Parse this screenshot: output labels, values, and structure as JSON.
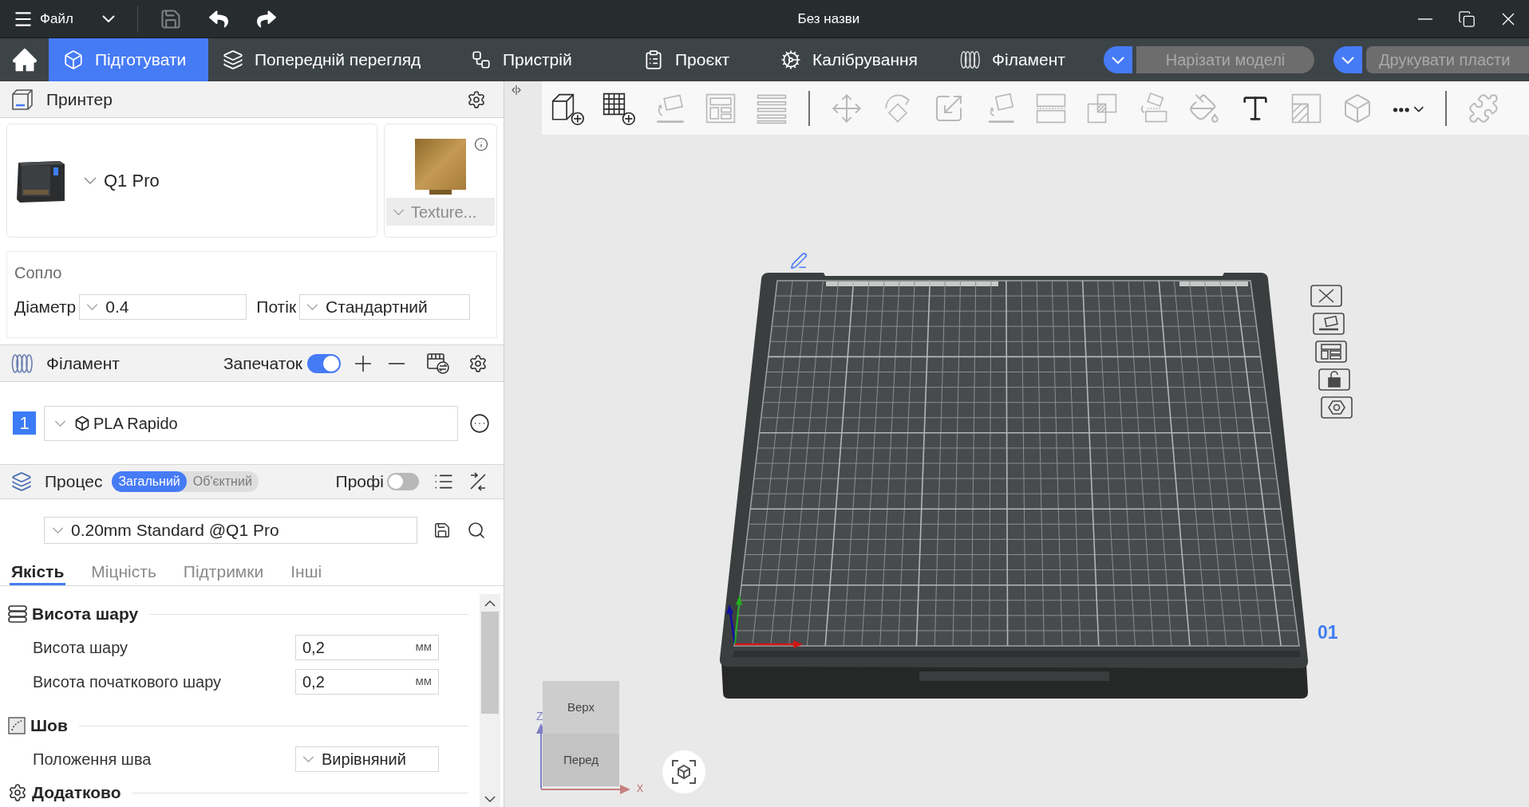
{
  "title_bar": {
    "menu_label": "Файл",
    "title": "Без назви",
    "quick_actions": [
      {
        "disabled": true
      },
      {
        "disabled": false
      },
      {
        "disabled": false
      }
    ]
  },
  "main_tabs": [
    {
      "label": "Підготувати",
      "selected": true
    },
    {
      "label": "Попередній перегляд",
      "selected": false
    },
    {
      "label": "Пристрій",
      "selected": false
    },
    {
      "label": "Проєкт",
      "selected": false
    },
    {
      "label": "Калібрування",
      "selected": false
    },
    {
      "label": "Філамент",
      "selected": false
    }
  ],
  "actions": [
    {
      "label": "Нарізати моделі",
      "disabled": true
    },
    {
      "label": "Друкувати пласти",
      "disabled": true
    }
  ],
  "printer": {
    "title": "Принтер",
    "model": "Q1 Pro",
    "plate_type": "Texture..."
  },
  "nozzle": {
    "title": "Сопло",
    "diameter_label": "Діаметр",
    "diameter": "0.4",
    "flow_label": "Потік",
    "flow": "Стандартний"
  },
  "filament": {
    "title": "Філамент",
    "afterprint_label": "Запечаток",
    "afterprint_on": true,
    "items": [
      {
        "number": "1",
        "name": "PLA Rapido",
        "color": "#3b7bf6"
      }
    ]
  },
  "process": {
    "title": "Процес",
    "modes": [
      {
        "label": "Загальний",
        "selected": true
      },
      {
        "label": "Об'єктний",
        "selected": false
      }
    ],
    "pro_label": "Профі",
    "pro_on": false,
    "preset": "0.20mm Standard @Q1 Pro",
    "tabs": [
      {
        "label": "Якість",
        "selected": true
      },
      {
        "label": "Міцність",
        "selected": false
      },
      {
        "label": "Підтримки",
        "selected": false
      },
      {
        "label": "Інші",
        "selected": false
      }
    ],
    "groups": [
      {
        "title": "Висота шару",
        "settings": [
          {
            "kind": "number",
            "label": "Висота шару",
            "value": "0,2",
            "unit": "мм"
          },
          {
            "kind": "number",
            "label": "Висота початкового шару",
            "value": "0,2",
            "unit": "мм"
          }
        ]
      },
      {
        "title": "Шов",
        "settings": [
          {
            "kind": "select",
            "label": "Положення шва",
            "value": "Вирівняний"
          }
        ]
      },
      {
        "title": "Додатково"
      }
    ]
  },
  "toolbar": [
    {
      "disabled": false
    },
    {
      "disabled": false
    },
    {
      "disabled": true
    },
    {
      "disabled": true
    },
    {
      "disabled": true
    },
    {
      "disabled": true
    },
    {
      "disabled": true
    },
    {
      "disabled": true
    },
    {
      "disabled": true
    },
    {
      "disabled": true
    },
    {
      "disabled": true
    },
    {
      "disabled": true
    },
    {
      "disabled": true
    },
    {
      "disabled": false
    },
    {
      "disabled": true
    },
    {
      "disabled": true
    },
    {
      "disabled": false
    },
    {
      "disabled": true
    }
  ],
  "viewport": {
    "plate_number": "01",
    "view_cube": {
      "top": "Верх",
      "front": "Перед"
    },
    "axis_labels": {
      "z": "Z",
      "x": "x"
    }
  }
}
